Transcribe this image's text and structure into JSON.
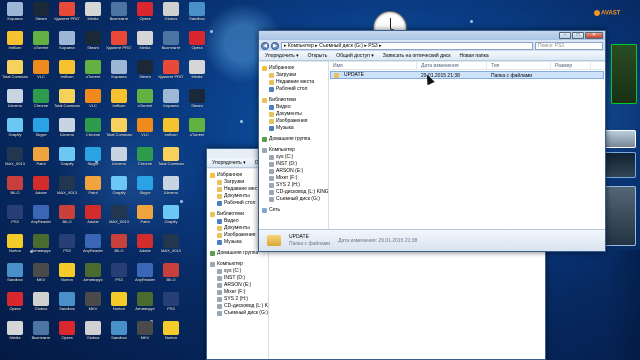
{
  "desktop": {
    "icons": [
      {
        "label": "Корзина",
        "color": "#9fb7d6"
      },
      {
        "label": "ImBurn",
        "color": "#f7c22f"
      },
      {
        "label": "Total Commander",
        "color": "#f6d15c"
      },
      {
        "label": "Штатно",
        "color": "#c9d4e2"
      },
      {
        "label": "Grapify",
        "color": "#6cc7f4"
      },
      {
        "label": "MAX_0013",
        "color": "#22364f"
      },
      {
        "label": "BILO",
        "color": "#c8403b"
      },
      {
        "label": "PS3",
        "color": "#273f74"
      },
      {
        "label": "Norton",
        "color": "#f5cb29"
      },
      {
        "label": "Sandbox",
        "color": "#4a90c8"
      },
      {
        "label": "Opera",
        "color": "#d9272d"
      },
      {
        "label": "Media",
        "color": "#d6d6d6"
      },
      {
        "label": "Steam",
        "color": "#1b2838"
      },
      {
        "label": "uTorrent",
        "color": "#63b142"
      },
      {
        "label": "VLC",
        "color": "#f08a1c"
      },
      {
        "label": "Chrome",
        "color": "#2f9c4d"
      },
      {
        "label": "Skype",
        "color": "#2aa3e4"
      },
      {
        "label": "Paint",
        "color": "#f1a33e"
      },
      {
        "label": "Adobe",
        "color": "#d32c2c"
      },
      {
        "label": "AnyReader",
        "color": "#3a66b5"
      },
      {
        "label": "Антивирус",
        "color": "#4b6a2e"
      },
      {
        "label": "MKV",
        "color": "#4a4a4a"
      },
      {
        "label": "Globus",
        "color": "#d0d0d0"
      },
      {
        "label": "Вконтакте",
        "color": "#4c75a3"
      },
      {
        "label": "Удалите PROTO",
        "color": "#e94a37"
      }
    ]
  },
  "gadgets": {
    "avast_label": "AVAST"
  },
  "main_window": {
    "address": "▸ Компьютер ▸ Съемный диск (G:) ▸ PS3 ▸",
    "search_placeholder": "Поиск: PS3",
    "toolbar": [
      "Упорядочить ▾",
      "Открыть",
      "Общий доступ ▾",
      "Записать на оптический диск",
      "Новая папка"
    ],
    "nav": [
      {
        "label": "Избранное",
        "icon": "star",
        "sub": false
      },
      {
        "label": "Загрузки",
        "icon": "folder",
        "sub": true
      },
      {
        "label": "Недавние места",
        "icon": "folder",
        "sub": true
      },
      {
        "label": "Рабочий стол",
        "icon": "blue",
        "sub": true
      },
      {
        "gap": true
      },
      {
        "label": "Библиотеки",
        "icon": "folder",
        "sub": false
      },
      {
        "label": "Видео",
        "icon": "blue",
        "sub": true
      },
      {
        "label": "Документы",
        "icon": "folder",
        "sub": true
      },
      {
        "label": "Изображения",
        "icon": "folder",
        "sub": true
      },
      {
        "label": "Музыка",
        "icon": "blue",
        "sub": true
      },
      {
        "gap": true
      },
      {
        "label": "Домашняя группа",
        "icon": "home",
        "sub": false
      },
      {
        "gap": true
      },
      {
        "label": "Компьютер",
        "icon": "drive",
        "sub": false
      },
      {
        "label": "sys (C:)",
        "icon": "drive",
        "sub": true
      },
      {
        "label": "INST (D:)",
        "icon": "drive",
        "sub": true
      },
      {
        "label": "ARSON (E:)",
        "icon": "drive",
        "sub": true
      },
      {
        "label": "Mixer (F:)",
        "icon": "drive",
        "sub": true
      },
      {
        "label": "SYS 2 (H:)",
        "icon": "drive",
        "sub": true
      },
      {
        "label": "CD-дисковод (L:) KINGS",
        "icon": "drive",
        "sub": true
      },
      {
        "label": "Съемный диск (G:)",
        "icon": "drive",
        "sub": true
      },
      {
        "gap": true
      },
      {
        "label": "Сеть",
        "icon": "net",
        "sub": false
      }
    ],
    "columns": [
      "Имя",
      "Дата изменения",
      "Тип",
      "Размер"
    ],
    "rows": [
      {
        "name": "UPDATE",
        "date": "29.01.2015 21:38",
        "type": "Папка с файлами",
        "size": ""
      }
    ],
    "details": {
      "name": "UPDATE",
      "date_label": "Дата изменения: 29.01.2015 21:38",
      "type": "Папка с файлами"
    }
  },
  "back_window": {
    "toolbar": [
      "Упорядочить ▾",
      "Общий доступ ▾",
      "Записать на оптический диск"
    ],
    "nav": [
      {
        "label": "Избранное",
        "icon": "star",
        "sub": false
      },
      {
        "label": "Загрузки",
        "icon": "folder",
        "sub": true
      },
      {
        "label": "Недавние места",
        "icon": "folder",
        "sub": true
      },
      {
        "label": "Документы",
        "icon": "folder",
        "sub": true
      },
      {
        "label": "Рабочий стол",
        "icon": "blue",
        "sub": true
      },
      {
        "gap": true
      },
      {
        "label": "Библиотеки",
        "icon": "folder",
        "sub": false
      },
      {
        "label": "Видео",
        "icon": "blue",
        "sub": true
      },
      {
        "label": "Документы",
        "icon": "folder",
        "sub": true
      },
      {
        "label": "Изображения",
        "icon": "folder",
        "sub": true
      },
      {
        "label": "Музыка",
        "icon": "blue",
        "sub": true
      },
      {
        "gap": true
      },
      {
        "label": "Домашняя группа",
        "icon": "home",
        "sub": false
      },
      {
        "gap": true
      },
      {
        "label": "Компьютер",
        "icon": "drive",
        "sub": false
      },
      {
        "label": "sys (C:)",
        "icon": "drive",
        "sub": true
      },
      {
        "label": "INST (D:)",
        "icon": "drive",
        "sub": true
      },
      {
        "label": "ARSON (E:)",
        "icon": "drive",
        "sub": true
      },
      {
        "label": "Mixer (F:)",
        "icon": "drive",
        "sub": true
      },
      {
        "label": "SYS 2 (H:)",
        "icon": "drive",
        "sub": true
      },
      {
        "label": "CD-дисковод (L:) KINGS",
        "icon": "drive",
        "sub": true
      },
      {
        "label": "Съемный диск (G:)",
        "icon": "drive",
        "sub": true
      }
    ]
  }
}
